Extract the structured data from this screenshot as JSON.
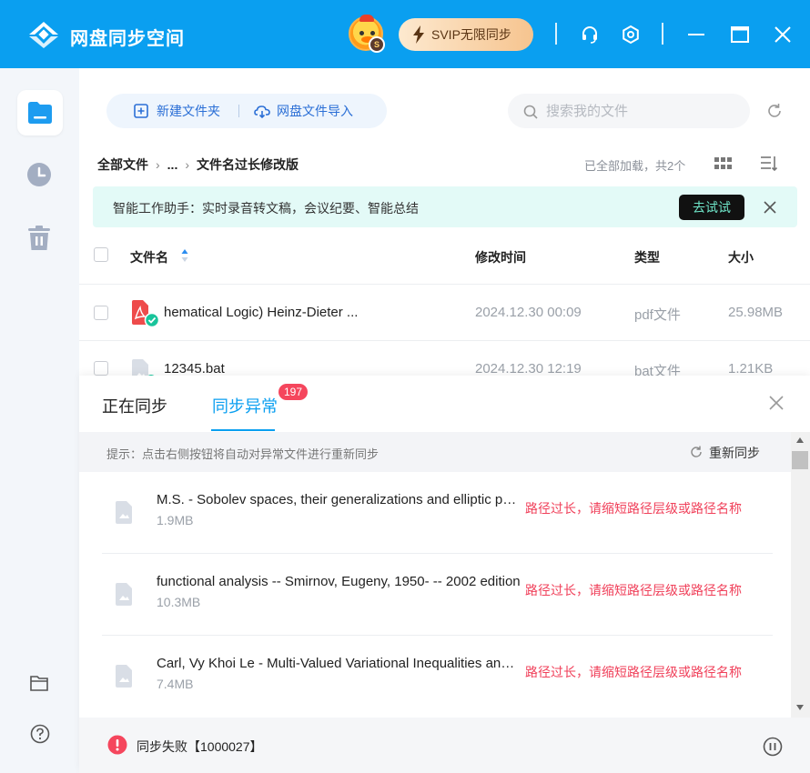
{
  "titlebar": {
    "app_title": "网盘同步空间",
    "svip_label": "SVIP无限同步",
    "avatar_badge": "S",
    "accent_color": "#0a9ff0",
    "icons": [
      "headset-icon",
      "settings-icon",
      "minimize-icon",
      "maximize-icon",
      "close-icon"
    ]
  },
  "sidebar": {
    "items": [
      "folder-icon",
      "recent-clock-icon",
      "trash-icon"
    ],
    "bottom_items": [
      "folder-outline-icon",
      "help-icon"
    ]
  },
  "toolbar": {
    "new_folder_label": "新建文件夹",
    "import_label": "网盘文件导入",
    "search_placeholder": "搜索我的文件"
  },
  "breadcrumb": {
    "root": "全部文件",
    "ellipsis": "...",
    "current": "文件名过长修改版"
  },
  "loaded_status": "已全部加载，共2个",
  "banner": {
    "text": "智能工作助手：实时录音转文稿，会议纪要、智能总结",
    "button_label": "去试试"
  },
  "table": {
    "columns": {
      "name": "文件名",
      "modified": "修改时间",
      "type": "类型",
      "size": "大小"
    },
    "rows": [
      {
        "name": "hematical Logic) Heinz-Dieter ...",
        "modified": "2024.12.30 00:09",
        "type": "pdf文件",
        "size": "25.98MB",
        "icon": "pdf-file-icon"
      },
      {
        "name": "12345.bat",
        "modified": "2024.12.30 12:19",
        "type": "bat文件",
        "size": "1.21KB",
        "icon": "generic-file-icon"
      }
    ]
  },
  "sync_panel": {
    "tab_syncing": "正在同步",
    "tab_errors": "同步异常",
    "error_count": "197",
    "tip": "提示：点击右侧按钮将自动对异常文件进行重新同步",
    "resync_label": "重新同步",
    "errors": [
      {
        "name": "M.S. - Sobolev spaces, their generalizations and elliptic problems",
        "size": "1.9MB",
        "message": "路径过长，请缩短路径层级或路径名称"
      },
      {
        "name": "functional analysis -- Smirnov, Eugeny, 1950- -- 2002 edition",
        "size": "10.3MB",
        "message": "路径过长，请缩短路径层级或路径名称"
      },
      {
        "name": "Carl, Vy Khoi Le - Multi-Valued Variational Inequalities and Inclusions",
        "size": "7.4MB",
        "message": "路径过长，请缩短路径层级或路径名称"
      }
    ],
    "footer_status": "同步失败【1000027】"
  }
}
